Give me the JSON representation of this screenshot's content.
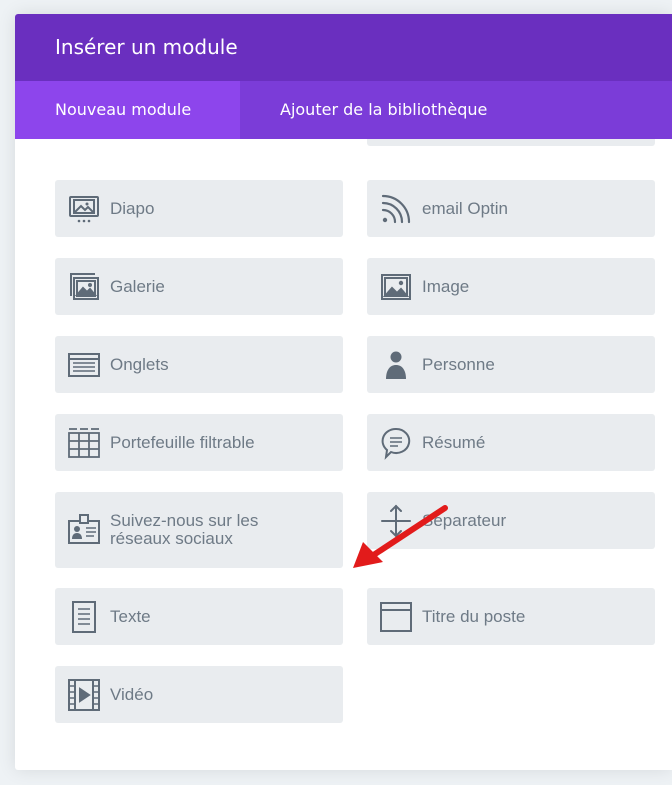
{
  "modal": {
    "title": "Insérer un module"
  },
  "tabs": [
    {
      "label": "Nouveau module",
      "active": true
    },
    {
      "label": "Ajouter de la bibliothèque",
      "active": false
    }
  ],
  "modules": [
    {
      "label": "Diapo",
      "icon": "slider-icon"
    },
    {
      "label": "email Optin",
      "icon": "rss-icon"
    },
    {
      "label": "Galerie",
      "icon": "gallery-icon"
    },
    {
      "label": "Image",
      "icon": "image-icon"
    },
    {
      "label": "Onglets",
      "icon": "tabs-icon"
    },
    {
      "label": "Personne",
      "icon": "person-icon"
    },
    {
      "label": "Portefeuille filtrable",
      "icon": "grid-icon"
    },
    {
      "label": "Résumé",
      "icon": "speech-bubble-icon"
    },
    {
      "label": "Suivez-nous sur les réseaux sociaux",
      "icon": "id-badge-icon"
    },
    {
      "label": "Séparateur",
      "icon": "divider-icon"
    },
    {
      "label": "Texte",
      "icon": "text-document-icon"
    },
    {
      "label": "Titre du poste",
      "icon": "post-title-icon"
    },
    {
      "label": "Vidéo",
      "icon": "video-icon"
    }
  ],
  "colors": {
    "header": "#6a2fbf",
    "tabs_bar": "#7b3cd8",
    "active_tab": "#8d45ec",
    "module_bg": "#e9ecef",
    "module_text": "#6e7a86",
    "icon": "#5f6b78",
    "annotation_arrow": "#e21b1b"
  }
}
